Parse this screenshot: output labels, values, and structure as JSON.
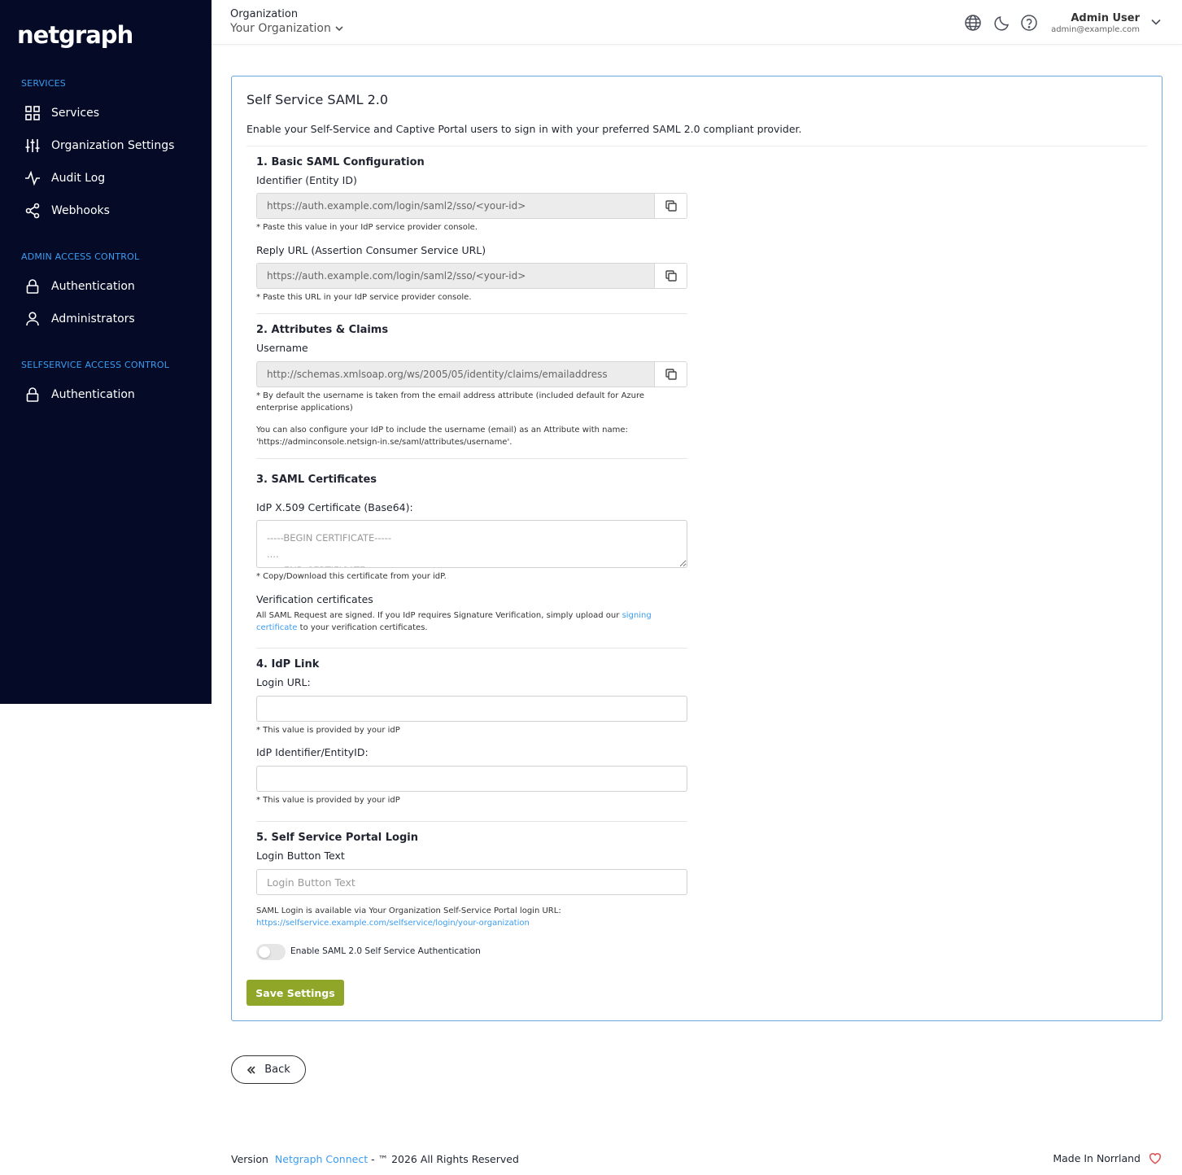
{
  "sidebar": {
    "logo": "netgraph",
    "sections": [
      {
        "title": "SERVICES",
        "items": [
          {
            "label": "Services",
            "icon": "grid-icon"
          },
          {
            "label": "Organization Settings",
            "icon": "sliders-icon"
          },
          {
            "label": "Audit Log",
            "icon": "activity-icon"
          },
          {
            "label": "Webhooks",
            "icon": "share-icon"
          }
        ]
      },
      {
        "title": "ADMIN ACCESS CONTROL",
        "items": [
          {
            "label": "Authentication",
            "icon": "lock-icon"
          },
          {
            "label": "Administrators",
            "icon": "user-icon"
          }
        ]
      },
      {
        "title": "SELFSERVICE ACCESS CONTROL",
        "items": [
          {
            "label": "Authentication",
            "icon": "lock-icon"
          }
        ]
      }
    ]
  },
  "header": {
    "org_label": "Organization",
    "org_value": "Your Organization",
    "user_name": "Admin User",
    "user_email": "admin@example.com"
  },
  "card": {
    "title": "Self Service SAML 2.0",
    "description": "Enable your Self-Service and Captive Portal users to sign in with your preferred SAML 2.0 compliant provider.",
    "basic": {
      "title": "1. Basic SAML Configuration",
      "identifier_label": "Identifier (Entity ID)",
      "identifier_value": "https://auth.example.com/login/saml2/sso/<your-id>",
      "identifier_hint": "* Paste this value in your IdP service provider console.",
      "reply_label": "Reply URL (Assertion Consumer Service URL)",
      "reply_value": "https://auth.example.com/login/saml2/sso/<your-id>",
      "reply_hint": "* Paste this URL in your IdP service provider console."
    },
    "attributes": {
      "title": "2. Attributes & Claims",
      "username_label": "Username",
      "username_value": "http://schemas.xmlsoap.org/ws/2005/05/identity/claims/emailaddress",
      "hint1": "* By default the username is taken from the email address attribute (included default for Azure enterprise applications)",
      "hint2": "You can also configure your IdP to include the username (email) as an Attribute with name: 'https://adminconsole.netsign-in.se/saml/attributes/username'."
    },
    "certs": {
      "title": "3. SAML Certificates",
      "cert_label": "IdP X.509 Certificate (Base64):",
      "cert_placeholder": "-----BEGIN CERTIFICATE-----\n....\n-----END CERTIFICATE-----",
      "cert_hint": "* Copy/Download this certificate from your idP.",
      "verify_label": "Verification certificates",
      "verify_text_before": "All SAML Request are signed. If you IdP requires Signature Verification, simply upload our ",
      "verify_link": "signing certificate",
      "verify_text_after": " to your verification certificates."
    },
    "idp": {
      "title": "4. IdP Link",
      "login_url_label": "Login URL:",
      "login_url_value": "",
      "login_url_hint": "* This value is provided by your idP",
      "entity_label": "IdP Identifier/EntityID:",
      "entity_value": "",
      "entity_hint": "* This value is provided by your idP"
    },
    "portal": {
      "title": "5. Self Service Portal Login",
      "button_text_label": "Login Button Text",
      "button_text_placeholder": "Login Button Text",
      "info_text": "SAML Login is available via Your Organization Self-Service Portal login URL:",
      "info_link": "https://selfservice.example.com/selfservice/login/your-organization",
      "toggle_label": "Enable SAML 2.0 Self Service Authentication"
    },
    "save_label": "Save Settings"
  },
  "back_label": "Back",
  "footer": {
    "version_prefix": "Version",
    "version_link": "Netgraph Connect",
    "rights": "- ™ 2026 All Rights Reserved",
    "made_in": "Made In Norrland"
  },
  "colors": {
    "sidebar_bg": "#050b27",
    "accent_blue": "#3b9cf0",
    "save_green": "#8fa628",
    "card_border": "#6aa7e0",
    "heart": "#e05252"
  }
}
